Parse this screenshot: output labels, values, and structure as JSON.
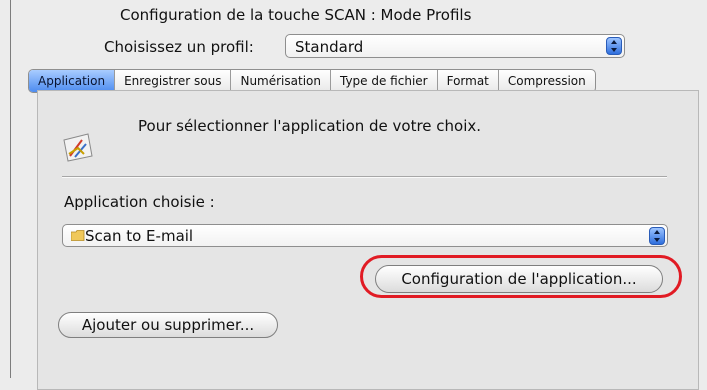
{
  "header": {
    "title": "Configuration de la touche SCAN : Mode Profils",
    "profile_label": "Choisissez un profil:",
    "profile_value": "Standard"
  },
  "tabs": [
    {
      "label": "Application",
      "active": true
    },
    {
      "label": "Enregistrer sous",
      "active": false
    },
    {
      "label": "Numérisation",
      "active": false
    },
    {
      "label": "Type de fichier",
      "active": false
    },
    {
      "label": "Format",
      "active": false
    },
    {
      "label": "Compression",
      "active": false
    }
  ],
  "panel": {
    "intro": "Pour sélectionner l'application de votre choix.",
    "app_label": "Application choisie :",
    "app_value": "Scan to E-mail",
    "config_button": "Configuration de l'application...",
    "add_remove_button": "Ajouter ou supprimer..."
  },
  "colors": {
    "highlight": "#e11b24",
    "accent": "#4d8cf0"
  },
  "icons": {
    "app": "application-icon",
    "folder": "folder-icon",
    "stepper": "popup-arrows-icon"
  }
}
